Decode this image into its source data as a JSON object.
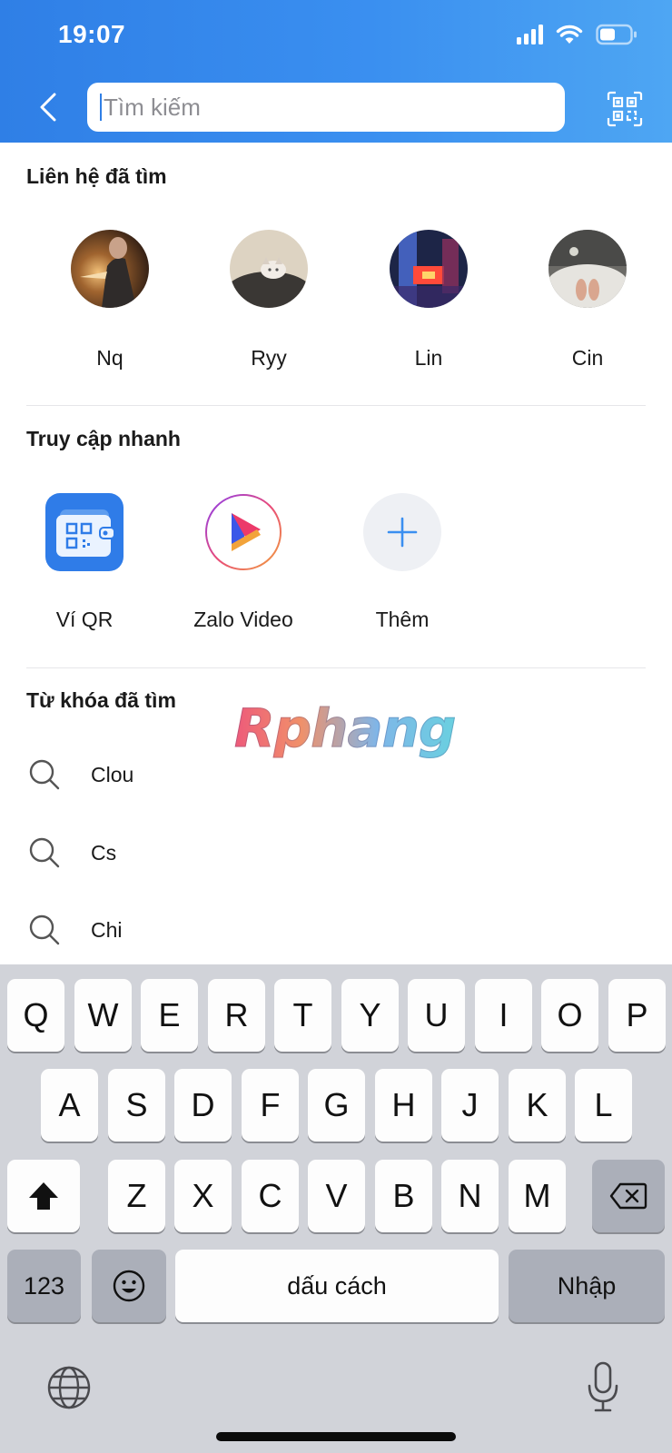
{
  "status_bar": {
    "time": "19:07"
  },
  "search": {
    "placeholder": "Tìm kiếm",
    "value": ""
  },
  "icons": {
    "back": "chevron-left-icon",
    "qr_scan": "qr-scan-icon",
    "search": "search-icon",
    "globe": "globe-icon",
    "mic": "microphone-icon",
    "shift": "shift-icon",
    "delete": "backspace-icon",
    "emoji": "emoji-icon"
  },
  "colors": {
    "header_start": "#2f7fe6",
    "header_end": "#4ea6f3",
    "accent": "#2f7fe6",
    "keyboard_bg": "#d1d3d9"
  },
  "recent_contacts": {
    "title": "Liên hệ đã tìm",
    "items": [
      {
        "name": "Nq"
      },
      {
        "name": "Ryy"
      },
      {
        "name": "Lin"
      },
      {
        "name": "Cin"
      }
    ]
  },
  "quick_access": {
    "title": "Truy cập nhanh",
    "items": [
      {
        "label": "Ví QR",
        "icon": "qr-wallet-icon"
      },
      {
        "label": "Zalo Video",
        "icon": "zalo-video-icon"
      },
      {
        "label": "Thêm",
        "icon": "plus-icon"
      }
    ]
  },
  "recent_keywords": {
    "title": "Từ khóa đã tìm",
    "items": [
      {
        "text": "Clou"
      },
      {
        "text": "Cs"
      },
      {
        "text": "Chi"
      }
    ]
  },
  "watermark": "Rphang",
  "keyboard": {
    "row1": [
      "Q",
      "W",
      "E",
      "R",
      "T",
      "Y",
      "U",
      "I",
      "O",
      "P"
    ],
    "row2": [
      "A",
      "S",
      "D",
      "F",
      "G",
      "H",
      "J",
      "K",
      "L"
    ],
    "row3": [
      "Z",
      "X",
      "C",
      "V",
      "B",
      "N",
      "M"
    ],
    "numbers_label": "123",
    "space_label": "dấu cách",
    "return_label": "Nhập"
  }
}
